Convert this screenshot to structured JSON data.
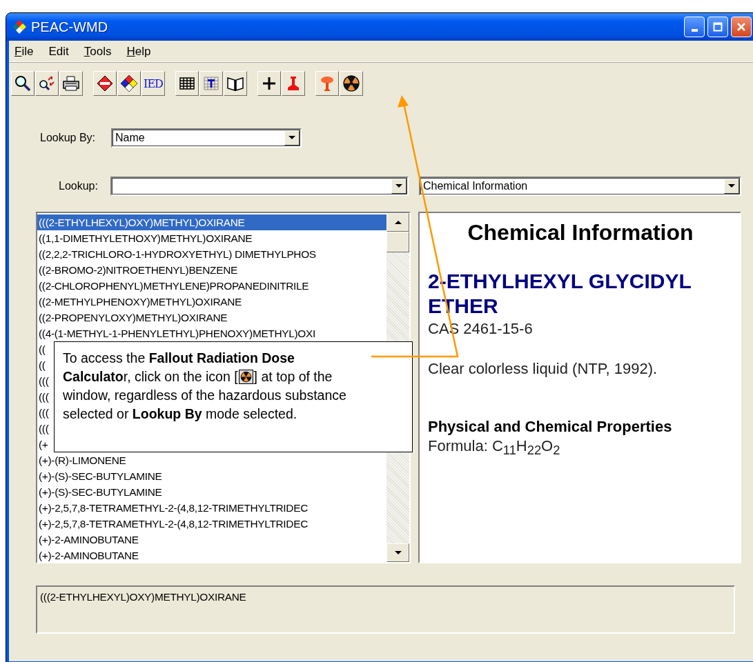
{
  "window": {
    "title": "PEAC-WMD"
  },
  "menu": [
    {
      "label": "File",
      "underline_first": true
    },
    {
      "label": "Edit",
      "underline_first": false
    },
    {
      "label": "Tools",
      "underline_first": true
    },
    {
      "label": "Help",
      "underline_first": true
    }
  ],
  "toolbar": [
    [
      {
        "kind": "magnifier"
      },
      {
        "kind": "magnifier-arrows"
      },
      {
        "kind": "printer"
      }
    ],
    [
      {
        "kind": "red-diamond"
      },
      {
        "kind": "nfpa-diamond"
      },
      {
        "kind": "text",
        "label": "IED"
      }
    ],
    [
      {
        "kind": "grid"
      },
      {
        "kind": "grid-t"
      },
      {
        "kind": "book"
      }
    ],
    [
      {
        "kind": "plus"
      },
      {
        "kind": "stamp"
      }
    ],
    [
      {
        "kind": "mushroom-cloud"
      },
      {
        "kind": "radiation"
      }
    ]
  ],
  "lookup_by": {
    "label": "Lookup By:",
    "value": "Name"
  },
  "lookup": {
    "label": "Lookup:"
  },
  "view_select": {
    "value": "Chemical Information"
  },
  "list": [
    {
      "text": "(((2-ETHYLHEXYL)OXY)METHYL)OXIRANE",
      "selected": true
    },
    {
      "text": "((1,1-DIMETHYLETHOXY)METHYL)OXIRANE",
      "selected": false
    },
    {
      "text": "((2,2,2-TRICHLORO-1-HYDROXYETHYL) DIMETHYLPHOS",
      "selected": false
    },
    {
      "text": "((2-BROMO-2)NITROETHENYL)BENZENE",
      "selected": false
    },
    {
      "text": "((2-CHLOROPHENYL)METHYLENE)PROPANEDINITRILE",
      "selected": false
    },
    {
      "text": "((2-METHYLPHENOXY)METHYL)OXIRANE",
      "selected": false
    },
    {
      "text": "((2-PROPENYLOXY)METHYL)OXIRANE",
      "selected": false
    },
    {
      "text": "((4-(1-METHYL-1-PHENYLETHYL)PHENOXY)METHYL)OXI",
      "selected": false
    },
    {
      "text": "((",
      "selected": false
    },
    {
      "text": "((",
      "selected": false
    },
    {
      "text": "(((",
      "selected": false
    },
    {
      "text": "(((",
      "selected": false
    },
    {
      "text": "(((",
      "selected": false
    },
    {
      "text": "(((",
      "selected": false
    },
    {
      "text": "(+",
      "selected": false
    },
    {
      "text": "(+)-(R)-LIMONENE",
      "selected": false
    },
    {
      "text": "(+)-(S)-SEC-BUTYLAMINE",
      "selected": false
    },
    {
      "text": "(+)-(S)-SEC-BUTYLAMINE",
      "selected": false
    },
    {
      "text": "(+)-2,5,7,8-TETRAMETHYL-2-(4,8,12-TRIMETHYLTRIDEC",
      "selected": false
    },
    {
      "text": "(+)-2,5,7,8-TETRAMETHYL-2-(4,8,12-TRIMETHYLTRIDEC",
      "selected": false
    },
    {
      "text": "(+)-2-AMINOBUTANE",
      "selected": false
    },
    {
      "text": "(+)-2-AMINOBUTANE",
      "selected": false
    }
  ],
  "info": {
    "heading": "Chemical Information",
    "name": "2-ETHYLHEXYL GLYCIDYL ETHER",
    "cas": "CAS 2461-15-6",
    "description": "Clear colorless liquid (NTP, 1992).",
    "section": "Physical and Chemical Properties",
    "formula": "Formula: C$_{11}$H$_{22}$O$_{2}$"
  },
  "status_text": "(((2-ETHYLHEXYL)OXY)METHYL)OXIRANE",
  "callout": {
    "first_line": "To access the **Fallout Radiation Dose**",
    "before_icon": "**Calculato**r, click on the icon [",
    "after_icon": "] at top of the",
    "rest": "window, regardless of the hazardous substance selected or **Lookup By** mode selected."
  }
}
